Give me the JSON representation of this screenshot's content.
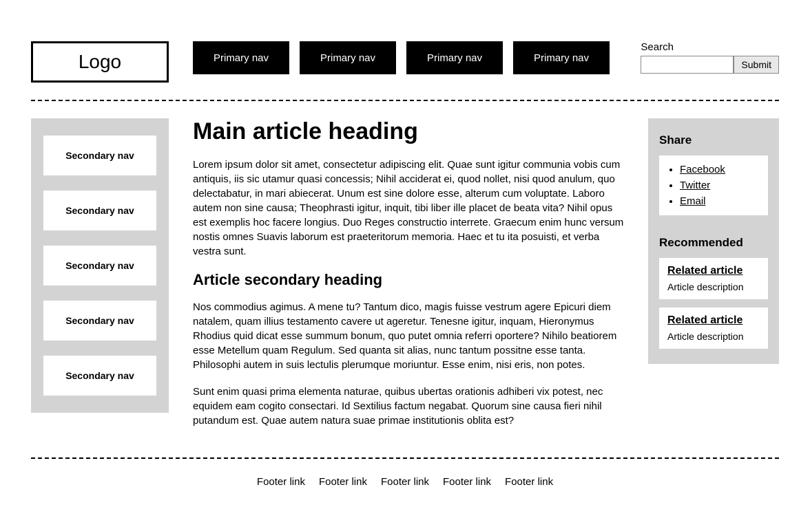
{
  "logo_text": "Logo",
  "primary_nav": [
    "Primary nav",
    "Primary nav",
    "Primary nav",
    "Primary nav"
  ],
  "search": {
    "label": "Search",
    "submit": "Submit"
  },
  "secondary_nav": [
    "Secondary nav",
    "Secondary nav",
    "Secondary nav",
    "Secondary nav",
    "Secondary nav"
  ],
  "article": {
    "heading": "Main article heading",
    "p1": "Lorem ipsum dolor sit amet, consectetur adipiscing elit. Quae sunt igitur communia vobis cum antiquis, iis sic utamur quasi concessis; Nihil acciderat ei, quod nollet, nisi quod anulum, quo delectabatur, in mari abiecerat. Unum est sine dolore esse, alterum cum voluptate. Laboro autem non sine causa; Theophrasti igitur, inquit, tibi liber ille placet de beata vita? Nihil opus est exemplis hoc facere longius. Duo Reges constructio interrete. Graecum enim hunc versum nostis omnes Suavis laborum est praeteritorum memoria. Haec et tu ita posuisti, et verba vestra sunt.",
    "subheading": "Article secondary heading",
    "p2": "Nos commodius agimus. A mene tu? Tantum dico, magis fuisse vestrum agere Epicuri diem natalem, quam illius testamento cavere ut ageretur. Tenesne igitur, inquam, Hieronymus Rhodius quid dicat esse summum bonum, quo putet omnia referri oportere? Nihilo beatiorem esse Metellum quam Regulum. Sed quanta sit alias, nunc tantum possitne esse tanta. Philosophi autem in suis lectulis plerumque moriuntur. Esse enim, nisi eris, non potes.",
    "p3": "Sunt enim quasi prima elementa naturae, quibus ubertas orationis adhiberi vix potest, nec equidem eam cogito consectari. Id Sextilius factum negabat. Quorum sine causa fieri nihil putandum est. Quae autem natura suae primae institutionis oblita est?"
  },
  "share": {
    "heading": "Share",
    "links": [
      "Facebook",
      "Twitter",
      "Email"
    ]
  },
  "recommended": {
    "heading": "Recommended",
    "items": [
      {
        "title": "Related article",
        "desc": "Article description"
      },
      {
        "title": "Related article",
        "desc": "Article description"
      }
    ]
  },
  "footer_links": [
    "Footer link",
    "Footer link",
    "Footer link",
    "Footer link",
    "Footer link"
  ]
}
